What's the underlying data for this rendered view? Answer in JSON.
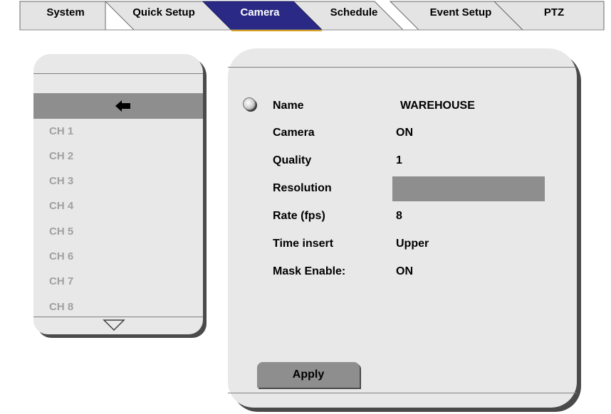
{
  "tabs": [
    {
      "label": "System",
      "active": false
    },
    {
      "label": "Quick Setup",
      "active": false
    },
    {
      "label": "Camera",
      "active": true
    },
    {
      "label": "Schedule",
      "active": false
    },
    {
      "label": "Event Setup",
      "active": false
    },
    {
      "label": "PTZ",
      "active": false
    }
  ],
  "channels": {
    "back_icon": "left-arrow-icon",
    "items": [
      "CH 1",
      "CH 2",
      "CH 3",
      "CH 4",
      "CH 5",
      "CH 6",
      "CH 7",
      "CH 8"
    ],
    "scroll_icon": "triangle-down-icon"
  },
  "settings": {
    "fields": [
      {
        "label": "Name",
        "value": "WAREHOUSE"
      },
      {
        "label": "Camera",
        "value": "ON"
      },
      {
        "label": "Quality",
        "value": "1"
      },
      {
        "label": "Resolution",
        "value": ""
      },
      {
        "label": "Rate (fps)",
        "value": "8"
      },
      {
        "label": "Time insert",
        "value": "Upper"
      },
      {
        "label": "Mask Enable:",
        "value": "ON"
      }
    ],
    "apply_label": "Apply"
  },
  "colors": {
    "active_tab": "#2a2a86",
    "inactive_tab": "#e4e4e4",
    "panel": "#e8e8e8",
    "highlight": "#8e8e8e"
  }
}
